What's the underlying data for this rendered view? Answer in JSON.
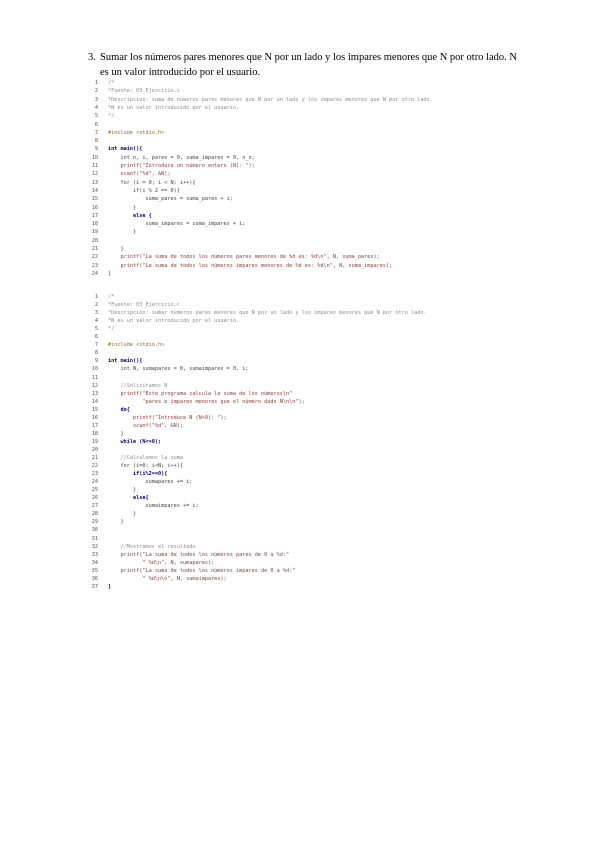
{
  "task": {
    "number": "3.",
    "text": "Sumar los números pares menores que N por un lado y los impares menores que N por otro lado. N es un valor introducido por el usuario."
  },
  "code_block_1": {
    "lines": [
      {
        "n": "1",
        "t": "/*",
        "k": "com"
      },
      {
        "n": "2",
        "t": "*Fuente: 03_Ejercicio.c",
        "k": "com"
      },
      {
        "n": "3",
        "t": "*Descripción: suma de números pares menores que N por un lado y los impares menores que N por otro lado.",
        "k": "com"
      },
      {
        "n": "4",
        "t": "*N es un valor introducido por el usuario.",
        "k": "com"
      },
      {
        "n": "5",
        "t": "*/",
        "k": "com"
      },
      {
        "n": "6",
        "t": "",
        "k": "txt"
      },
      {
        "n": "7",
        "t": "#include <stdio.h>",
        "k": "pre"
      },
      {
        "n": "8",
        "t": "",
        "k": "txt"
      },
      {
        "n": "9",
        "t": "int main(){",
        "k": "kw"
      },
      {
        "n": "10",
        "t": "    int n, i, pares = 0, suma_impares = 0, n_n;",
        "k": "txt"
      },
      {
        "n": "11",
        "t": "    printf(\"Introduce un número entero (N): \");",
        "k": "str"
      },
      {
        "n": "12",
        "t": "    scanf(\"%d\", &N);",
        "k": "str"
      },
      {
        "n": "13",
        "t": "    for (i = 0; i < N; i++){",
        "k": "txt"
      },
      {
        "n": "14",
        "t": "        if(i % 2 == 0){",
        "k": "txt"
      },
      {
        "n": "15",
        "t": "            suma_pares = suma_pares + i;",
        "k": "txt"
      },
      {
        "n": "16",
        "t": "        }",
        "k": "txt"
      },
      {
        "n": "17",
        "t": "        else {",
        "k": "kw"
      },
      {
        "n": "18",
        "t": "            suma_impares = suma_impares + i;",
        "k": "txt"
      },
      {
        "n": "19",
        "t": "        }",
        "k": "txt"
      },
      {
        "n": "20",
        "t": "",
        "k": "txt"
      },
      {
        "n": "21",
        "t": "    }",
        "k": "txt"
      },
      {
        "n": "22",
        "t": "    printf(\"La suma de todos los números pares menores de %d es: %d\\n\", N, suma_pares);",
        "k": "str"
      },
      {
        "n": "23",
        "t": "    printf(\"La suma de todos los números impares menores de %d es: %d\\n\", N, suma_impares);",
        "k": "str"
      },
      {
        "n": "24",
        "t": "}",
        "k": "txt"
      }
    ]
  },
  "code_block_2": {
    "lines": [
      {
        "n": "1",
        "t": "/*",
        "k": "com"
      },
      {
        "n": "2",
        "t": "*Fuente: 03_Ejercicio.c",
        "k": "com"
      },
      {
        "n": "3",
        "t": "*Descripción: sumar números pares menores que N por un lado y los impares menores que N por otro lado.",
        "k": "com"
      },
      {
        "n": "4",
        "t": "*N es un valor introducido por el usuario.",
        "k": "com"
      },
      {
        "n": "5",
        "t": "*/",
        "k": "com"
      },
      {
        "n": "6",
        "t": "",
        "k": "txt"
      },
      {
        "n": "7",
        "t": "#include <stdio.h>",
        "k": "pre"
      },
      {
        "n": "8",
        "t": "",
        "k": "txt"
      },
      {
        "n": "9",
        "t": "int main(){",
        "k": "kw"
      },
      {
        "n": "10",
        "t": "    int N, sumapares = 0, sumaimpares = 0, i;",
        "k": "txt"
      },
      {
        "n": "11",
        "t": "",
        "k": "txt"
      },
      {
        "n": "12",
        "t": "    //Solicitamos N",
        "k": "com"
      },
      {
        "n": "13",
        "t": "    printf(\"Este programa calcula la suma de los números\\n\"",
        "k": "str"
      },
      {
        "n": "14",
        "t": "           \"pares e impares menores que el número dado N\\n\\n\");",
        "k": "str"
      },
      {
        "n": "15",
        "t": "    do{",
        "k": "kw"
      },
      {
        "n": "16",
        "t": "        printf(\"Introduce N (N>0): \");",
        "k": "str"
      },
      {
        "n": "17",
        "t": "        scanf(\"%d\", &N);",
        "k": "str"
      },
      {
        "n": "18",
        "t": "    }",
        "k": "txt"
      },
      {
        "n": "19",
        "t": "    while (N<=0);",
        "k": "kw"
      },
      {
        "n": "20",
        "t": "",
        "k": "txt"
      },
      {
        "n": "21",
        "t": "    //Calculamos la suma",
        "k": "com"
      },
      {
        "n": "22",
        "t": "    for (i=0; i<N; i++){",
        "k": "txt"
      },
      {
        "n": "23",
        "t": "        if(i%2==0){",
        "k": "kw"
      },
      {
        "n": "24",
        "t": "            sumapares += i;",
        "k": "txt"
      },
      {
        "n": "25",
        "t": "        }",
        "k": "txt"
      },
      {
        "n": "26",
        "t": "        else{",
        "k": "kw"
      },
      {
        "n": "27",
        "t": "            sumaimpares += i;",
        "k": "txt"
      },
      {
        "n": "28",
        "t": "        }",
        "k": "txt"
      },
      {
        "n": "29",
        "t": "    }",
        "k": "txt"
      },
      {
        "n": "30",
        "t": "",
        "k": "txt"
      },
      {
        "n": "31",
        "t": "",
        "k": "txt"
      },
      {
        "n": "32",
        "t": "    //Mostramos el resultado",
        "k": "com"
      },
      {
        "n": "33",
        "t": "    printf(\"La suma de todos los números pares de 0 a %d:\"",
        "k": "str"
      },
      {
        "n": "34",
        "t": "           \" %d\\n\", N, sumapares);",
        "k": "str"
      },
      {
        "n": "35",
        "t": "    printf(\"La suma de todos los números impares de 0 a %d:\"",
        "k": "str"
      },
      {
        "n": "36",
        "t": "           \" %d\\n\\n\", N, sumaimpares);",
        "k": "str"
      },
      {
        "n": "37",
        "t": "}",
        "k": "kw"
      }
    ]
  }
}
